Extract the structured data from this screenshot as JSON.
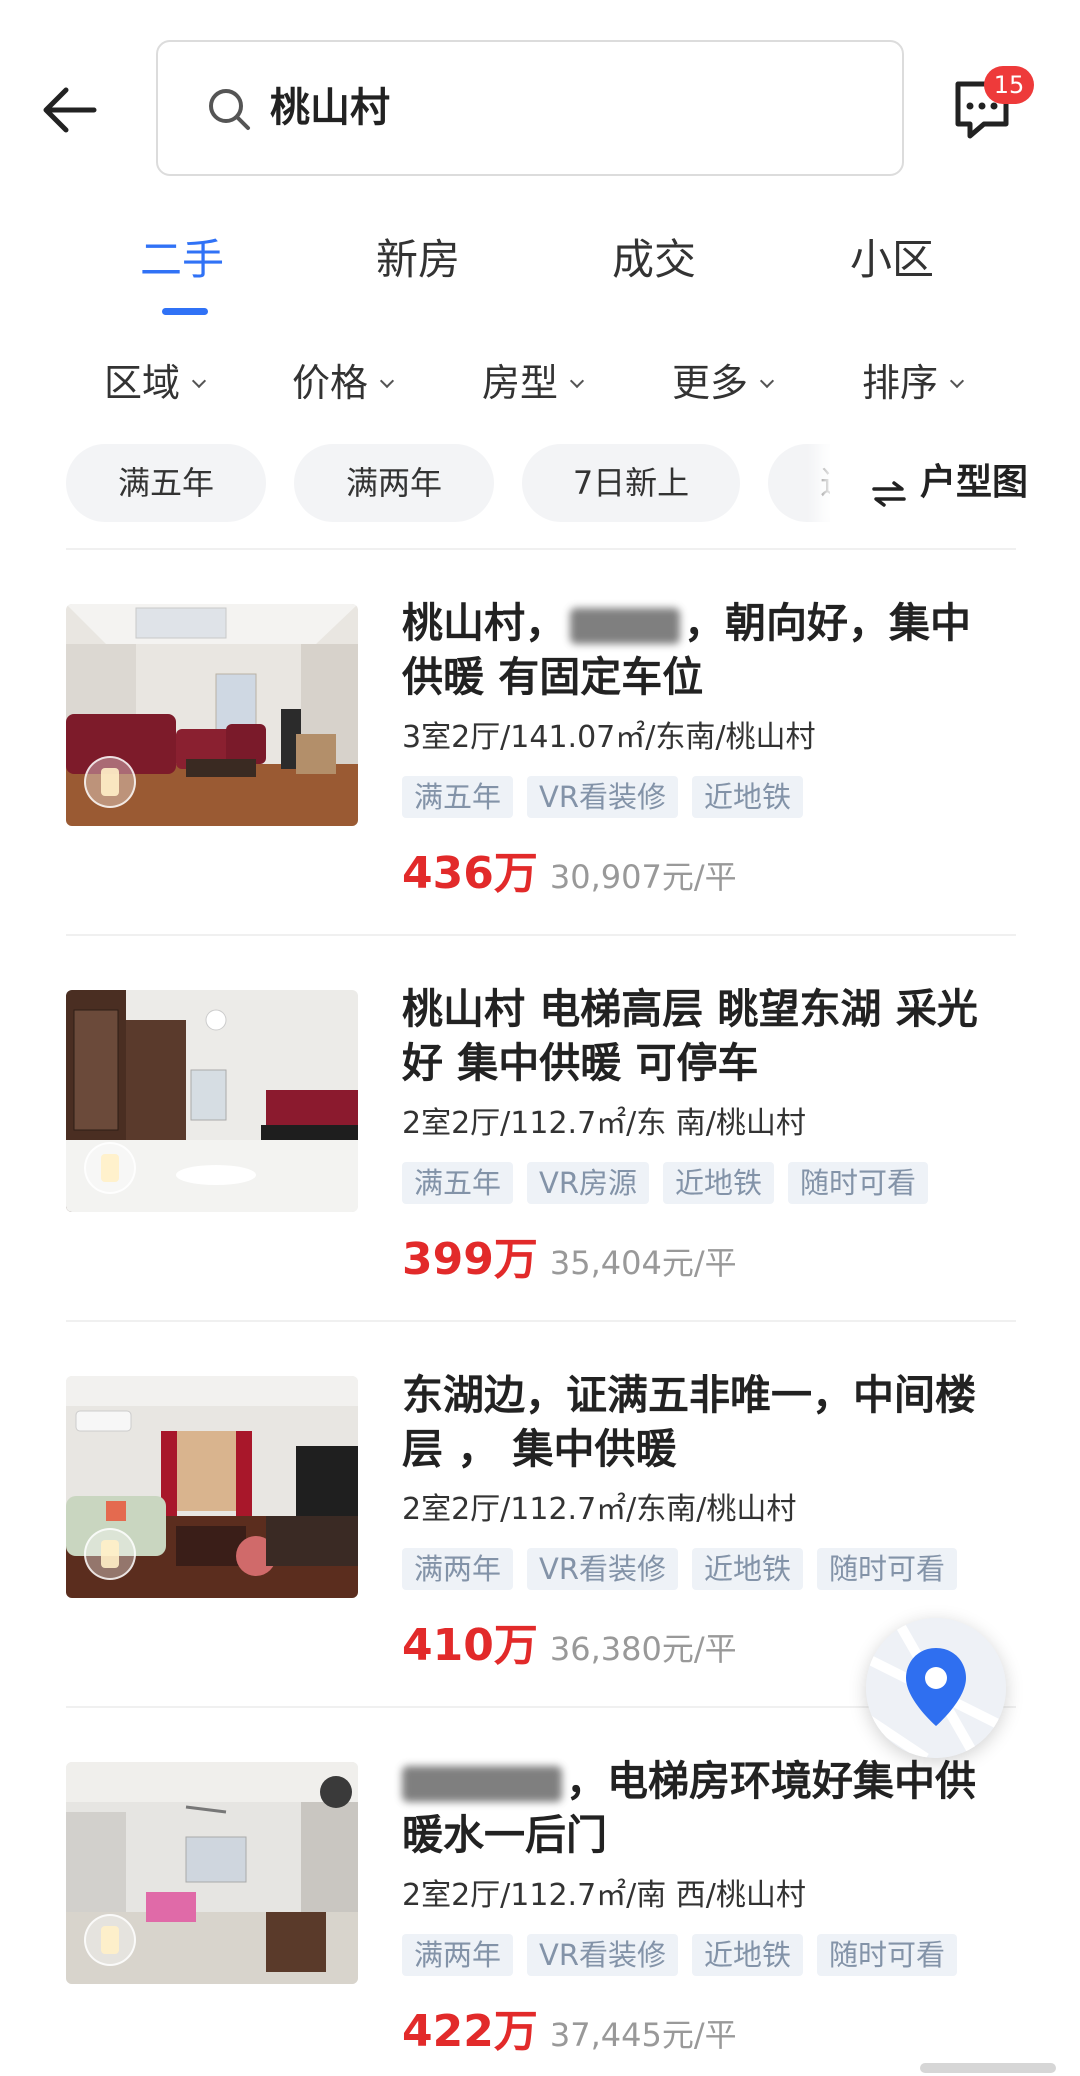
{
  "search": {
    "query": "桃山村"
  },
  "messages": {
    "badge": "15"
  },
  "tabs": [
    {
      "label": "二手",
      "active": true
    },
    {
      "label": "新房",
      "active": false
    },
    {
      "label": "成交",
      "active": false
    },
    {
      "label": "小区",
      "active": false
    }
  ],
  "filters": [
    "区域",
    "价格",
    "房型",
    "更多",
    "排序"
  ],
  "chips": [
    "满五年",
    "满两年",
    "7日新上",
    "近"
  ],
  "floor_plan_label": "户型图",
  "listings": [
    {
      "title_before": "桃山村，",
      "title_after": "，朝向好，集中供暖 有固定车位",
      "spec": "3室2厅/141.07㎡/东南/桃山村",
      "tags": [
        "满五年",
        "VR看装修",
        "近地铁"
      ],
      "price": "436万",
      "unit_price": "30,907元/平"
    },
    {
      "title_before": "桃山村 电梯高层 眺望东湖 采光好 集中供暖 可停车",
      "title_after": "",
      "spec": "2室2厅/112.7㎡/东 南/桃山村",
      "tags": [
        "满五年",
        "VR房源",
        "近地铁",
        "随时可看"
      ],
      "price": "399万",
      "unit_price": "35,404元/平"
    },
    {
      "title_before": "东湖边，证满五非唯一，中间楼层 ， 集中供暖",
      "title_after": "",
      "spec": "2室2厅/112.7㎡/东南/桃山村",
      "tags": [
        "满两年",
        "VR看装修",
        "近地铁",
        "随时可看"
      ],
      "price": "410万",
      "unit_price": "36,380元/平"
    },
    {
      "title_before": "",
      "title_after": "，电梯房环境好集中供暖水一后门",
      "spec": "2室2厅/112.7㎡/南 西/桃山村",
      "tags": [
        "满两年",
        "VR看装修",
        "近地铁",
        "随时可看"
      ],
      "price": "422万",
      "unit_price": "37,445元/平"
    }
  ],
  "colors": {
    "accent": "#3072f6",
    "price": "#e22a2a",
    "tag_bg": "#eef2f7",
    "tag_text": "#8393a8",
    "badge": "#ee3a3a"
  }
}
